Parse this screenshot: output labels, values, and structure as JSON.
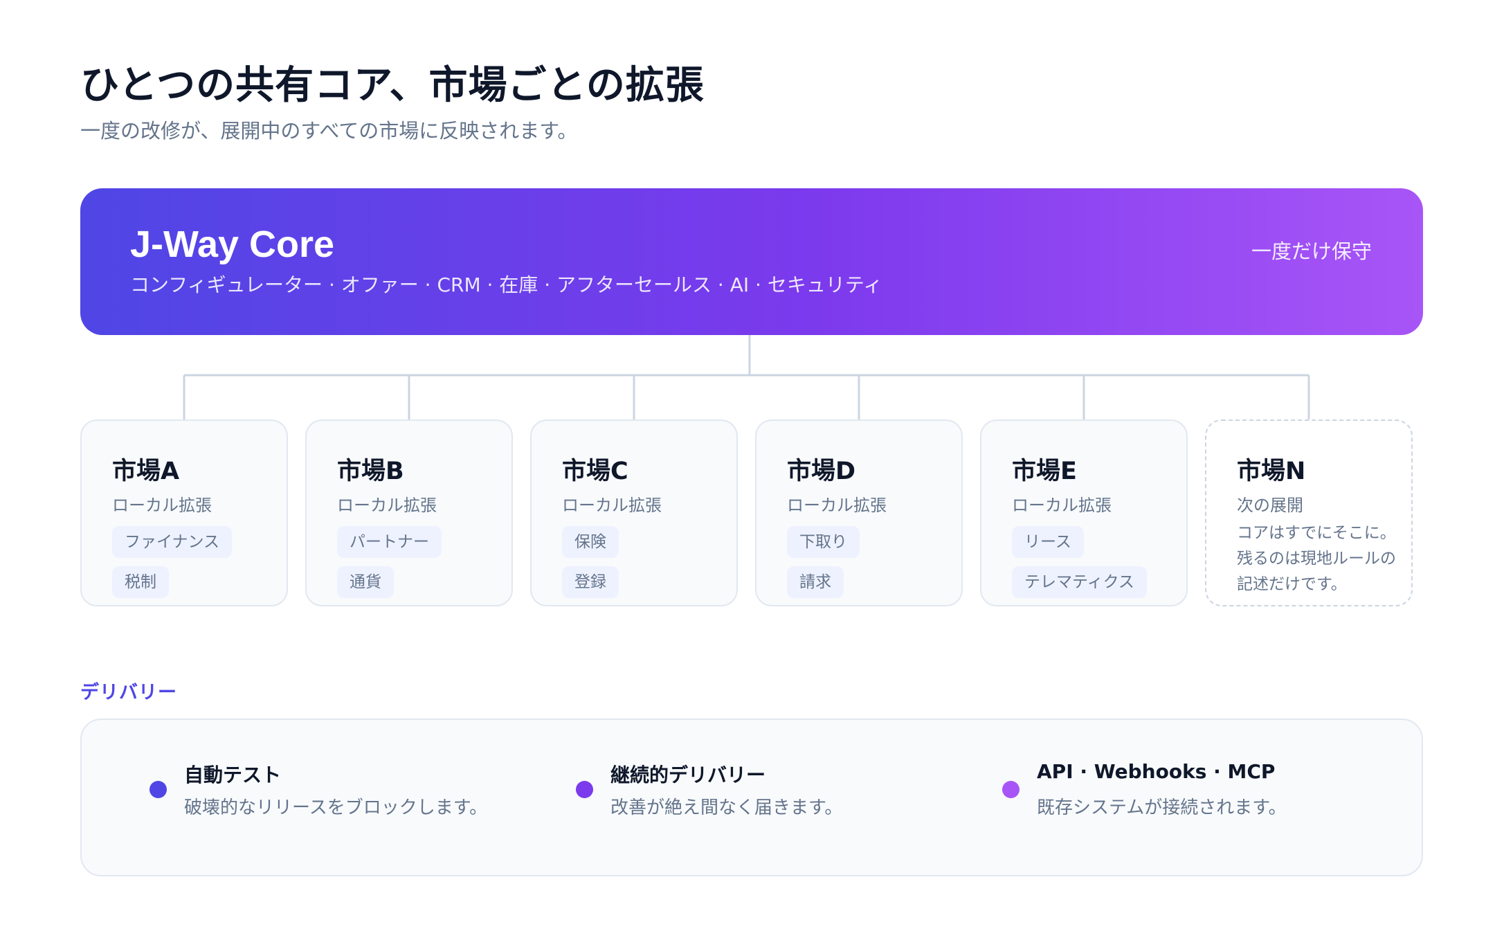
{
  "header": {
    "title": "ひとつの共有コア、市場ごとの拡張",
    "subtitle": "一度の改修が、展開中のすべての市場に反映されます。"
  },
  "core": {
    "title": "J-Way Core",
    "modules": "コンフィギュレーター · オファー · CRM · 在庫 · アフターセールス · AI · セキュリティ",
    "badge": "一度だけ保守",
    "gradient": [
      "#4f46e5",
      "#a855f7"
    ]
  },
  "markets": [
    {
      "name": "市場A",
      "subtitle": "ローカル拡張",
      "tags": [
        "ファイナンス",
        "税制"
      ]
    },
    {
      "name": "市場B",
      "subtitle": "ローカル拡張",
      "tags": [
        "パートナー",
        "通貨"
      ]
    },
    {
      "name": "市場C",
      "subtitle": "ローカル拡張",
      "tags": [
        "保険",
        "登録"
      ]
    },
    {
      "name": "市場D",
      "subtitle": "ローカル拡張",
      "tags": [
        "下取り",
        "請求"
      ]
    },
    {
      "name": "市場E",
      "subtitle": "ローカル拡張",
      "tags": [
        "リース",
        "テレマティクス"
      ]
    },
    {
      "name": "市場N",
      "subtitle": "次の展開",
      "note": "コアはすでにそこに。残るのは現地ルールの記述だけです。"
    }
  ],
  "delivery": {
    "label": "デリバリー",
    "items": [
      {
        "title": "自動テスト",
        "description": "破壊的なリリースをブロックします。",
        "dot_color": "#4f46e5"
      },
      {
        "title": "継続的デリバリー",
        "description": "改善が絶え間なく届きます。",
        "dot_color": "#7c3aed"
      },
      {
        "title": "API · Webhooks · MCP",
        "description": "既存システムが接続されます。",
        "dot_color": "#a855f7"
      }
    ]
  },
  "colors": {
    "connector": "#cbd5e1",
    "accent": "#4f46e5"
  }
}
